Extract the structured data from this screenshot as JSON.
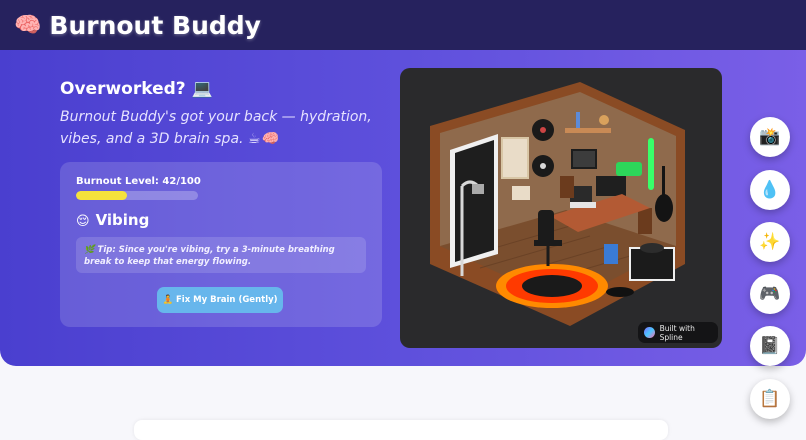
{
  "header": {
    "icon": "🧠",
    "title": "Burnout Buddy"
  },
  "hero": {
    "headline": "Overworked? 💻",
    "tagline": "Burnout Buddy's got your back — hydration, vibes, and a 3D brain spa. ☕🧠"
  },
  "status": {
    "level_label": "Burnout Level: 42/100",
    "level_value": 42,
    "level_max": 100,
    "bar_color": "#f5e23b",
    "mood_emoji": "😌",
    "mood": "Vibing",
    "tip": "🌿 Tip: Since you're vibing, try a 3-minute breathing break to keep that energy flowing.",
    "fix_button": "🧘 Fix My Brain (Gently)"
  },
  "scene": {
    "badge": "Built with Spline"
  },
  "sidebar_buttons": [
    {
      "icon": "📸",
      "name": "camera"
    },
    {
      "icon": "💧",
      "name": "water-drop"
    },
    {
      "icon": "✨",
      "name": "sparkles"
    },
    {
      "icon": "🎮",
      "name": "game-controller"
    },
    {
      "icon": "📓",
      "name": "journal"
    },
    {
      "icon": "📋",
      "name": "clipboard"
    }
  ]
}
